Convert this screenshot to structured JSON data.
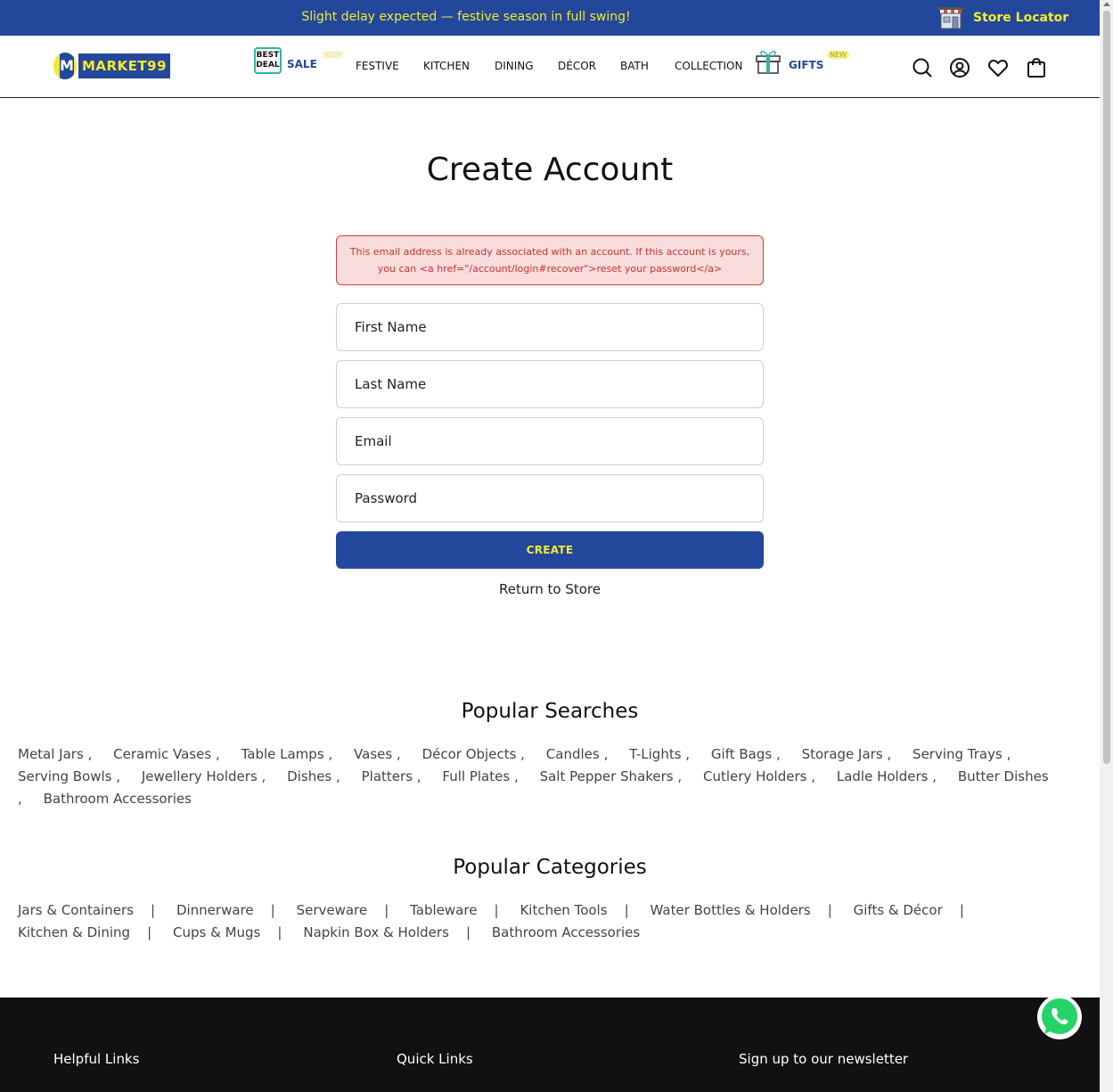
{
  "announcement": {
    "text": "Slight delay expected — festive season in full swing!",
    "store_locator": "Store Locator"
  },
  "logo": {
    "mark": "M",
    "text": "MARKET99"
  },
  "nav": {
    "best_deal": "BEST DEAL",
    "sale": "SALE",
    "sale_badge": "NEW",
    "items": [
      "FESTIVE",
      "KITCHEN",
      "DINING",
      "DÉCOR",
      "BATH",
      "COLLECTION"
    ],
    "gifts": "GIFTS",
    "gifts_badge": "NEW"
  },
  "header_icons": [
    "search-icon",
    "account-icon",
    "wishlist-icon",
    "cart-icon"
  ],
  "page": {
    "title": "Create Account",
    "error_line1": "This email address is already associated with an account. If this account is yours,",
    "error_line2": "you can <a href=\"/account/login#recover\">reset your password</a>",
    "fields": {
      "first_name": "First Name",
      "last_name": "Last Name",
      "email": "Email",
      "password": "Password"
    },
    "create_button": "CREATE",
    "return_link": "Return to Store"
  },
  "popular_searches": {
    "title": "Popular Searches",
    "items": [
      "Metal Jars",
      "Ceramic Vases",
      "Table Lamps",
      "Vases",
      "Décor Objects",
      "Candles",
      "T-Lights",
      "Gift Bags",
      "Storage Jars",
      "Serving Trays",
      "Serving Bowls",
      "Jewellery Holders",
      "Dishes",
      "Platters",
      "Full Plates",
      "Salt Pepper Shakers",
      "Cutlery Holders",
      "Ladle Holders",
      "Butter Dishes",
      "Bathroom Accessories"
    ]
  },
  "popular_categories": {
    "title": "Popular Categories",
    "items": [
      "Jars & Containers",
      "Dinnerware",
      "Serveware",
      "Tableware",
      "Kitchen Tools",
      "Water Bottles & Holders",
      "Gifts & Décor",
      "Kitchen & Dining",
      "Cups & Mugs",
      "Napkin Box & Holders",
      "Bathroom Accessories"
    ]
  },
  "footer": {
    "helpful_links": "Helpful Links",
    "quick_links": "Quick Links",
    "newsletter": "Sign up to our newsletter"
  },
  "colors": {
    "brand_blue": "#23479a",
    "brand_yellow": "#f2ea2f",
    "error_border": "#d43c3c",
    "error_bg": "#f9dcdc",
    "footer_bg": "#111111",
    "whatsapp_green": "#25d366"
  }
}
